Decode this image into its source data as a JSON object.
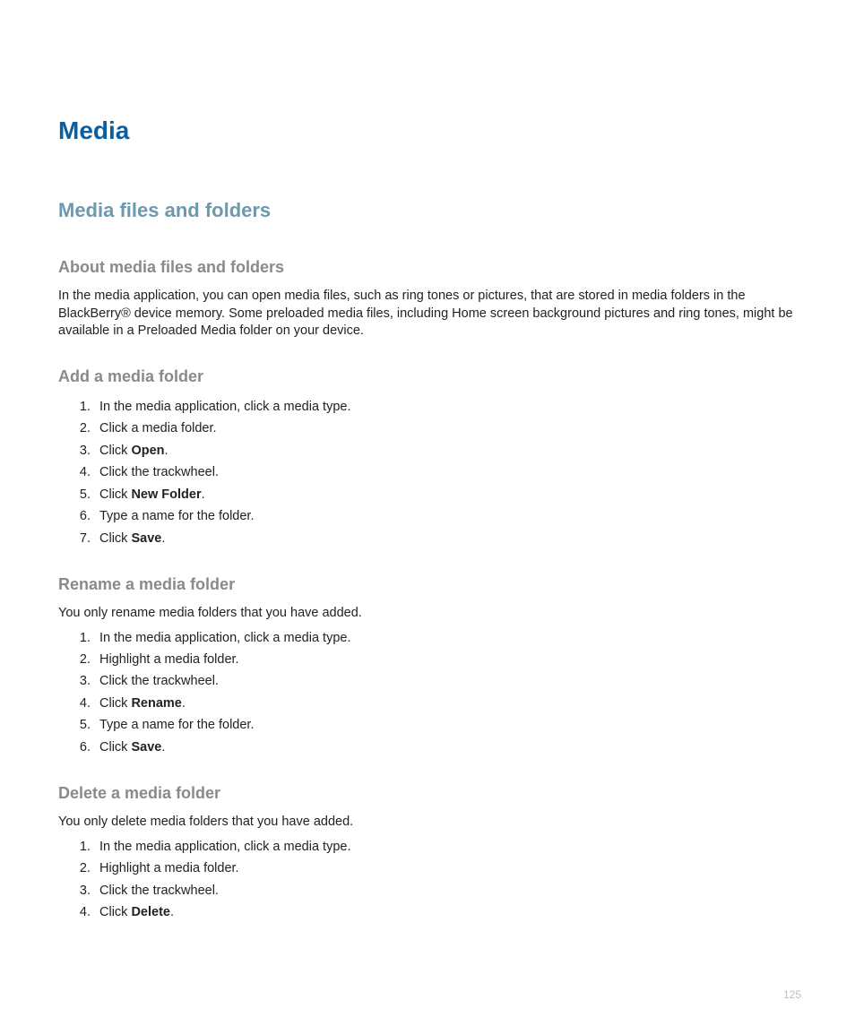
{
  "title": "Media",
  "section": "Media files and folders",
  "about": {
    "heading": "About media files and folders",
    "paragraph": "In the media application, you can open media files, such as ring tones or pictures, that are stored in media folders in the BlackBerry® device memory. Some preloaded media files, including Home screen background pictures and ring tones, might be available in a Preloaded Media folder on your device."
  },
  "add": {
    "heading": "Add a media folder",
    "steps": [
      [
        {
          "t": "In the media application, click a media type."
        }
      ],
      [
        {
          "t": "Click a media folder."
        }
      ],
      [
        {
          "t": "Click "
        },
        {
          "t": "Open",
          "b": true
        },
        {
          "t": "."
        }
      ],
      [
        {
          "t": "Click the trackwheel."
        }
      ],
      [
        {
          "t": "Click "
        },
        {
          "t": "New Folder",
          "b": true
        },
        {
          "t": "."
        }
      ],
      [
        {
          "t": "Type a name for the folder."
        }
      ],
      [
        {
          "t": "Click "
        },
        {
          "t": "Save",
          "b": true
        },
        {
          "t": "."
        }
      ]
    ]
  },
  "rename": {
    "heading": "Rename a media folder",
    "intro": "You only rename media folders that you have added.",
    "steps": [
      [
        {
          "t": "In the media application, click a media type."
        }
      ],
      [
        {
          "t": "Highlight a media folder."
        }
      ],
      [
        {
          "t": "Click the trackwheel."
        }
      ],
      [
        {
          "t": "Click "
        },
        {
          "t": "Rename",
          "b": true
        },
        {
          "t": "."
        }
      ],
      [
        {
          "t": "Type a name for the folder."
        }
      ],
      [
        {
          "t": "Click "
        },
        {
          "t": "Save",
          "b": true
        },
        {
          "t": "."
        }
      ]
    ]
  },
  "delete": {
    "heading": "Delete a media folder",
    "intro": "You only delete media folders that you have added.",
    "steps": [
      [
        {
          "t": "In the media application, click a media type."
        }
      ],
      [
        {
          "t": "Highlight a media folder."
        }
      ],
      [
        {
          "t": "Click the trackwheel."
        }
      ],
      [
        {
          "t": "Click "
        },
        {
          "t": "Delete",
          "b": true
        },
        {
          "t": "."
        }
      ]
    ]
  },
  "page_number": "125"
}
